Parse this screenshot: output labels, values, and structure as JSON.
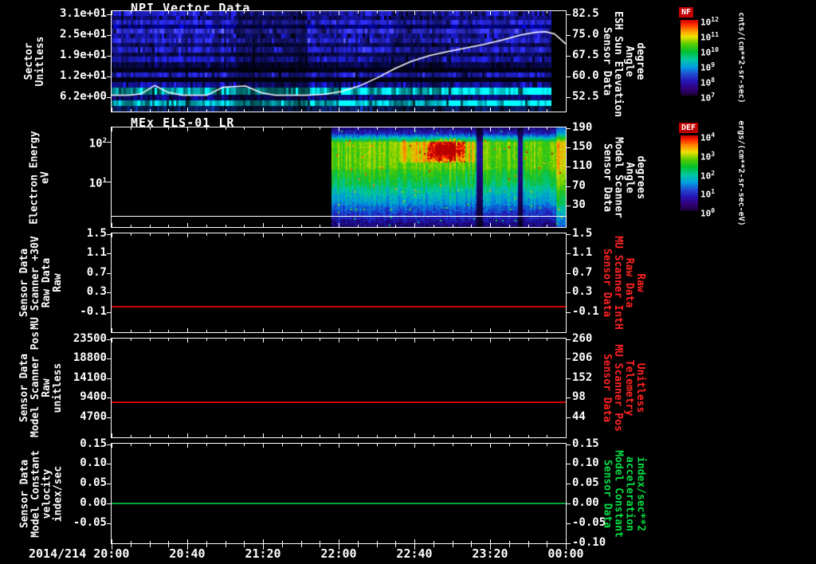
{
  "app": {
    "background": "#000000",
    "foreground": "#ffffff"
  },
  "xaxis": {
    "date_prefix": "2014/214",
    "tick_labels": [
      "20:00",
      "20:40",
      "21:20",
      "22:00",
      "22:40",
      "23:20",
      "00:00"
    ]
  },
  "colorbar_stops": [
    [
      0,
      "#cc0000"
    ],
    [
      0.06,
      "#ff2a00"
    ],
    [
      0.14,
      "#ff9000"
    ],
    [
      0.22,
      "#f0e000"
    ],
    [
      0.32,
      "#58cc00"
    ],
    [
      0.42,
      "#00c030"
    ],
    [
      0.52,
      "#00c8a0"
    ],
    [
      0.62,
      "#00a0e0"
    ],
    [
      0.72,
      "#2048d0"
    ],
    [
      0.82,
      "#2810b0"
    ],
    [
      0.92,
      "#300070"
    ],
    [
      1,
      "#180030"
    ]
  ],
  "chart_data": [
    {
      "type": "heatmap",
      "title": "NPI Vector Data",
      "y_left": {
        "title": [
          "Sector",
          "Unitless"
        ],
        "ticks": [
          {
            "label": "3.1e+01",
            "frac": 0.03
          },
          {
            "label": "2.5e+01",
            "frac": 0.2375
          },
          {
            "label": "1.9e+01",
            "frac": 0.445
          },
          {
            "label": "1.2e+01",
            "frac": 0.6525
          },
          {
            "label": "6.2e+00",
            "frac": 0.86
          }
        ]
      },
      "y_right": {
        "title": [
          "Sensor Data",
          "ESH Sun Elevation",
          "Angle",
          "degree"
        ],
        "color": "#ffffff",
        "ticks": [
          {
            "label": "82.5",
            "frac": 0.03
          },
          {
            "label": "75.0",
            "frac": 0.2375
          },
          {
            "label": "67.5",
            "frac": 0.445
          },
          {
            "label": "60.0",
            "frac": 0.6525
          },
          {
            "label": "52.5",
            "frac": 0.86
          }
        ]
      },
      "colorbar": {
        "name": "NF",
        "tick_labels": [
          "10^12",
          "10^11",
          "10^10",
          "10^9",
          "10^8",
          "10^7"
        ],
        "units": "cnts/(cm**2-sr-sec)"
      },
      "overlay_line": {
        "color": "#ffffff",
        "axis": {
          "v_top": 82.5,
          "f_top": 0.03,
          "v_bot": 52.5,
          "f_bot": 0.86
        },
        "points": [
          [
            0,
            53.3
          ],
          [
            0.04,
            53.3
          ],
          [
            0.065,
            53.8
          ],
          [
            0.095,
            56.8
          ],
          [
            0.125,
            54.3
          ],
          [
            0.155,
            53.3
          ],
          [
            0.21,
            53.3
          ],
          [
            0.245,
            56.2
          ],
          [
            0.295,
            56.6
          ],
          [
            0.33,
            54.2
          ],
          [
            0.36,
            53.3
          ],
          [
            0.43,
            53.3
          ],
          [
            0.47,
            53.7
          ],
          [
            0.505,
            54.6
          ],
          [
            0.545,
            56.6
          ],
          [
            0.585,
            59.6
          ],
          [
            0.625,
            63
          ],
          [
            0.66,
            65.5
          ],
          [
            0.7,
            67.6
          ],
          [
            0.74,
            69
          ],
          [
            0.78,
            70.3
          ],
          [
            0.82,
            71.6
          ],
          [
            0.86,
            73.2
          ],
          [
            0.9,
            75
          ],
          [
            0.935,
            76
          ],
          [
            0.955,
            76.2
          ],
          [
            0.975,
            75.4
          ],
          [
            1,
            71.8
          ]
        ]
      },
      "heatmap": {
        "data_start": 0.0,
        "data_end": 0.965,
        "bands": [
          {
            "y0": 0.0,
            "y1": 0.045,
            "color": "#1b1bb4"
          },
          {
            "y0": 0.045,
            "y1": 0.09,
            "color": "#0e0e78"
          },
          {
            "y0": 0.09,
            "y1": 0.135,
            "color": "#2424c8"
          },
          {
            "y0": 0.135,
            "y1": 0.175,
            "color": "#00027e"
          },
          {
            "y0": 0.175,
            "y1": 0.225,
            "color": "#2e2ed2"
          },
          {
            "y0": 0.225,
            "y1": 0.27,
            "color": "#14149e"
          },
          {
            "y0": 0.27,
            "y1": 0.315,
            "color": "#2222bc"
          },
          {
            "y0": 0.315,
            "y1": 0.36,
            "color": "#0b0b64"
          },
          {
            "y0": 0.36,
            "y1": 0.41,
            "color": "#2121c2"
          },
          {
            "y0": 0.41,
            "y1": 0.455,
            "color": "#090950"
          },
          {
            "y0": 0.455,
            "y1": 0.51,
            "color": "#1919ac"
          },
          {
            "y0": 0.51,
            "y1": 0.565,
            "color": "#070744"
          },
          {
            "y0": 0.565,
            "y1": 0.615,
            "color": "#02021c"
          },
          {
            "y0": 0.615,
            "y1": 0.655,
            "color": "#1e1eb8"
          },
          {
            "y0": 0.655,
            "y1": 0.705,
            "color": "#010114"
          },
          {
            "y0": 0.705,
            "y1": 0.765,
            "color": "#121296"
          },
          {
            "y0": 0.765,
            "y1": 0.835,
            "color": "#00d8e0",
            "ramp": true
          },
          {
            "y0": 0.835,
            "y1": 0.885,
            "color": "#0b0b74"
          },
          {
            "y0": 0.885,
            "y1": 0.945,
            "color": "#00cede",
            "ramp": true
          },
          {
            "y0": 0.945,
            "y1": 1.0,
            "color": "#061a55"
          }
        ],
        "column_dims": [
          {
            "t0": 0.27,
            "t1": 0.43,
            "factor": 0.55
          },
          {
            "t0": 0.47,
            "t1": 0.5,
            "factor": 0.8
          },
          {
            "t0": 0.62,
            "t1": 0.73,
            "factor": 0.7
          }
        ]
      }
    },
    {
      "type": "heatmap",
      "title": "MEx ELS-01 LR",
      "y_left": {
        "title": [
          "Electron Energy",
          "eV"
        ],
        "ticks": [
          {
            "label": "10^2",
            "frac": 0.145
          },
          {
            "label": "10^1",
            "frac": 0.545
          }
        ]
      },
      "y_right": {
        "title": [
          "Sensor Data",
          "Model Scanner",
          "Angle",
          "degrees"
        ],
        "color": "#ffffff",
        "ticks": [
          {
            "label": "190",
            "frac": 0.005
          },
          {
            "label": "150",
            "frac": 0.2
          },
          {
            "label": "110",
            "frac": 0.395
          },
          {
            "label": "70",
            "frac": 0.59
          },
          {
            "label": "30",
            "frac": 0.785
          }
        ]
      },
      "colorbar": {
        "name": "DEF",
        "tick_labels": [
          "10^4",
          "10^3",
          "10^2",
          "10^1",
          "10^0"
        ],
        "units": "ergs/(cm**2-sr-sec-eV)"
      },
      "overlay_line": {
        "color": "#ffffff",
        "frac": 0.89
      },
      "heatmap": {
        "data_start": 0.482,
        "data_end": 1.0,
        "profile": [
          {
            "f0": 0.0,
            "f1": 0.06,
            "v0": 0.1,
            "v1": 0.18
          },
          {
            "f0": 0.06,
            "f1": 0.13,
            "v0": 0.2,
            "v1": 0.5
          },
          {
            "f0": 0.13,
            "f1": 0.4,
            "v0": 0.6,
            "v1": 0.58
          },
          {
            "f0": 0.4,
            "f1": 0.58,
            "v0": 0.55,
            "v1": 0.44
          },
          {
            "f0": 0.58,
            "f1": 0.78,
            "v0": 0.42,
            "v1": 0.28
          },
          {
            "f0": 0.78,
            "f1": 1.0,
            "v0": 0.26,
            "v1": 0.08
          }
        ],
        "warm_band": {
          "t0": 0.63,
          "t1": 0.81,
          "f0": 0.14,
          "f1": 0.34,
          "boost": 0.12
        },
        "hot_spot": {
          "t0": 0.69,
          "t1": 0.78,
          "f0": 0.1,
          "f1": 0.34,
          "boost": 0.35
        },
        "stripes": {
          "t0": 0.74,
          "t1": 0.81,
          "amp": 0.12
        },
        "gaps": [
          [
            0.803,
            0.817
          ],
          [
            0.893,
            0.905
          ]
        ],
        "edge_bright": {
          "t0": 0.978,
          "t1": 1.0,
          "boost": 0.15
        },
        "colormap": [
          [
            0,
            "#000010"
          ],
          [
            0.08,
            "#1a0060"
          ],
          [
            0.18,
            "#2020c0"
          ],
          [
            0.3,
            "#0090e0"
          ],
          [
            0.4,
            "#00c8a0"
          ],
          [
            0.5,
            "#10c030"
          ],
          [
            0.6,
            "#58cc00"
          ],
          [
            0.7,
            "#c8d800"
          ],
          [
            0.8,
            "#ff9800"
          ],
          [
            0.9,
            "#ff2800"
          ],
          [
            1,
            "#b80000"
          ]
        ]
      }
    },
    {
      "type": "line",
      "y_left": {
        "title": [
          "Sensor Data",
          "MU Scanner +30V",
          "Raw Data",
          "Raw"
        ],
        "ticks": [
          {
            "label": "1.5",
            "frac": 0.005
          },
          {
            "label": "1.1",
            "frac": 0.2
          },
          {
            "label": "0.7",
            "frac": 0.4
          },
          {
            "label": "0.3",
            "frac": 0.6
          },
          {
            "label": "-0.1",
            "frac": 0.8
          }
        ]
      },
      "y_right": {
        "title": [
          "Sensor Data",
          "MU Scanner IntH",
          "Raw Data",
          "Raw"
        ],
        "color": "#ff2222",
        "ticks": [
          {
            "label": "1.5",
            "frac": 0.005
          },
          {
            "label": "1.1",
            "frac": 0.2
          },
          {
            "label": "0.7",
            "frac": 0.4
          },
          {
            "label": "0.3",
            "frac": 0.6
          },
          {
            "label": "-0.1",
            "frac": 0.8
          }
        ]
      },
      "series": [
        {
          "name": "MU Scanner +30V Raw",
          "color": "#cc0000",
          "value": 0.02,
          "frac": 0.742
        }
      ]
    },
    {
      "type": "line",
      "y_left": {
        "title": [
          "Sensor Data",
          "Model Scanner Pos",
          "Raw",
          "unitless"
        ],
        "ticks": [
          {
            "label": "23500",
            "frac": 0.005
          },
          {
            "label": "18800",
            "frac": 0.2
          },
          {
            "label": "14100",
            "frac": 0.4
          },
          {
            "label": "9400",
            "frac": 0.6
          },
          {
            "label": "4700",
            "frac": 0.8
          }
        ]
      },
      "y_right": {
        "title": [
          "Sensor Data",
          "MU Scanner Pos",
          "Telemetry",
          "Unitless"
        ],
        "color": "#ff2222",
        "ticks": [
          {
            "label": "260",
            "frac": 0.005
          },
          {
            "label": "206",
            "frac": 0.2
          },
          {
            "label": "152",
            "frac": 0.4
          },
          {
            "label": "98",
            "frac": 0.6
          },
          {
            "label": "44",
            "frac": 0.8
          }
        ]
      },
      "series": [
        {
          "name": "Model Scanner Pos Raw",
          "color": "#cc0000",
          "value": 8340,
          "frac": 0.645
        }
      ]
    },
    {
      "type": "line",
      "y_left": {
        "title": [
          "Sensor Data",
          "Model Constant",
          "velocity",
          "index/sec"
        ],
        "ticks": [
          {
            "label": "0.15",
            "frac": 0.005
          },
          {
            "label": "0.10",
            "frac": 0.2
          },
          {
            "label": "0.05",
            "frac": 0.4
          },
          {
            "label": "0.00",
            "frac": 0.6
          },
          {
            "label": "-0.05",
            "frac": 0.8
          }
        ]
      },
      "y_right": {
        "title": [
          "Sensor Data",
          "Model Constant",
          "acceleration",
          "index/sec**2"
        ],
        "color": "#00dd44",
        "ticks": [
          {
            "label": "0.15",
            "frac": 0.005
          },
          {
            "label": "0.10",
            "frac": 0.2
          },
          {
            "label": "0.05",
            "frac": 0.4
          },
          {
            "label": "0.00",
            "frac": 0.6
          },
          {
            "label": "-0.05",
            "frac": 0.8
          },
          {
            "label": "-0.10",
            "frac": 1.0
          }
        ]
      },
      "series": [
        {
          "name": "Model Constant velocity",
          "color": "#00a33c",
          "value": 0.0,
          "frac": 0.6
        }
      ]
    }
  ]
}
